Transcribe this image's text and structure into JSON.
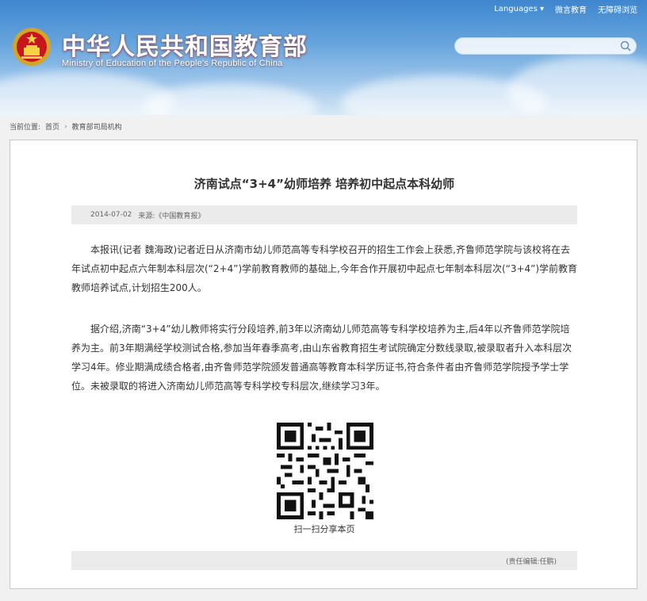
{
  "header": {
    "title": "中华人民共和国教育部",
    "subtitle": "Ministry of Education of the People's Republic of China",
    "top_links": [
      "Languages",
      "微言教育",
      "无障碍浏览"
    ],
    "search": {
      "value": ""
    }
  },
  "breadcrumb": {
    "prefix": "当前位置:",
    "items": [
      "首页",
      "教育部司局机构"
    ]
  },
  "article": {
    "title": "济南试点“3+4”幼师培养 培养初中起点本科幼师",
    "date": "2014-07-02",
    "source": "来源:《中国教育报》",
    "paragraphs": [
      "本报讯(记者 魏海政)记者近日从济南市幼儿师范高等专科学校召开的招生工作会上获悉,齐鲁师范学院与该校将在去年试点初中起点六年制本科层次(“2+4”)学前教育教师的基础上,今年合作开展初中起点七年制本科层次(“3+4”)学前教育教师培养试点,计划招生200人。",
      "据介绍,济南“3+4”幼儿教师将实行分段培养,前3年以济南幼儿师范高等专科学校培养为主,后4年以齐鲁师范学院培养为主。前3年期满经学校测试合格,参加当年春季高考,由山东省教育招生考试院确定分数线录取,被录取者升入本科层次学习4年。修业期满成绩合格者,由齐鲁师范学院颁发普通高等教育本科学历证书,符合条件者由齐鲁师范学院授予学士学位。未被录取的将进入济南幼儿师范高等专科学校专科层次,继续学习3年。"
    ],
    "qr_caption": "扫一扫分享本页",
    "editor": "(责任编辑:任鹏)"
  }
}
